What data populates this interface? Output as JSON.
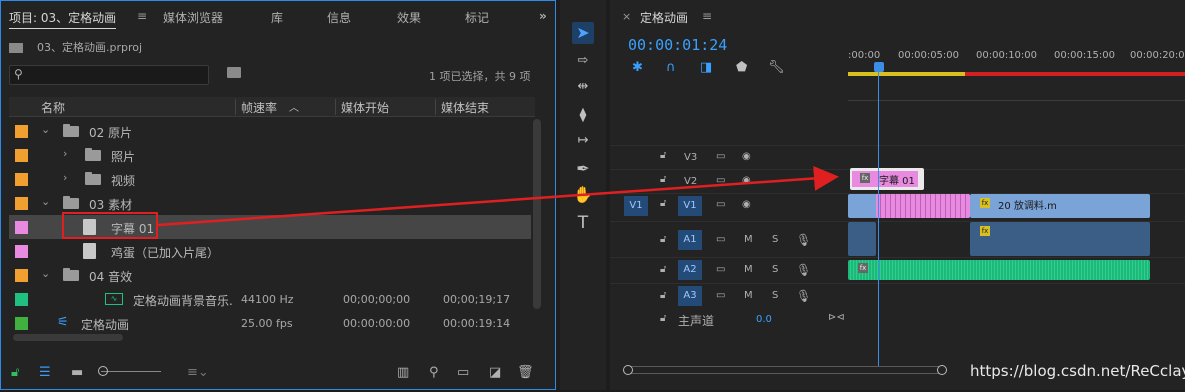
{
  "project": {
    "tabs": [
      {
        "label": "项目: 03、定格动画"
      },
      {
        "label": "媒体浏览器"
      },
      {
        "label": "库"
      },
      {
        "label": "信息"
      },
      {
        "label": "效果"
      },
      {
        "label": "标记"
      }
    ],
    "file": "03、定格动画.prproj",
    "search_placeholder": "",
    "status": "1 项已选择，共 9 项",
    "columns": {
      "name": "名称",
      "fps": "帧速率",
      "start": "媒体开始",
      "end": "媒体结束"
    },
    "rows": [
      {
        "label": "02 原片",
        "color": "#f0a030",
        "level": 0,
        "kind": "folder",
        "open": true
      },
      {
        "label": "照片",
        "color": "#f0a030",
        "level": 1,
        "kind": "folder",
        "open": false
      },
      {
        "label": "视频",
        "color": "#f0a030",
        "level": 1,
        "kind": "folder",
        "open": false
      },
      {
        "label": "03 素材",
        "color": "#f0a030",
        "level": 0,
        "kind": "folder",
        "open": true
      },
      {
        "label": "字幕 01",
        "color": "#e88ae0",
        "level": 1,
        "kind": "file",
        "selected": true
      },
      {
        "label": "鸡蛋（已加入片尾）",
        "color": "#e88ae0",
        "level": 1,
        "kind": "file"
      },
      {
        "label": "04 音效",
        "color": "#f0a030",
        "level": 0,
        "kind": "folder",
        "open": true
      },
      {
        "label": "定格动画背景音乐.",
        "color": "#20c080",
        "level": 1,
        "kind": "audio",
        "fps": "44100 Hz",
        "start": "00;00;00;00",
        "end": "00;00;19;17"
      },
      {
        "label": "定格动画",
        "color": "#40b040",
        "level": -1,
        "kind": "sequence",
        "fps": "25.00 fps",
        "start": "00:00:00:00",
        "end": "00:00:19:14"
      }
    ]
  },
  "timeline": {
    "title": "定格动画",
    "timecode": "00:00:01:24",
    "ruler_labels": [
      ":00:00",
      "00:00:05:00",
      "00:00:10:00",
      "00:00:15:00",
      "00:00:20:00"
    ],
    "video_tracks": [
      "V3",
      "V2",
      "V1"
    ],
    "audio_tracks": [
      "A1",
      "A2",
      "A3"
    ],
    "source_v": "V1",
    "master": "主声道",
    "master_value": "0.0",
    "clip_title": "字幕 01",
    "clip_v1": "20 放调料.m",
    "mute_label": "M",
    "solo_label": "S"
  },
  "watermark": "https://blog.csdn.net/ReCclay"
}
